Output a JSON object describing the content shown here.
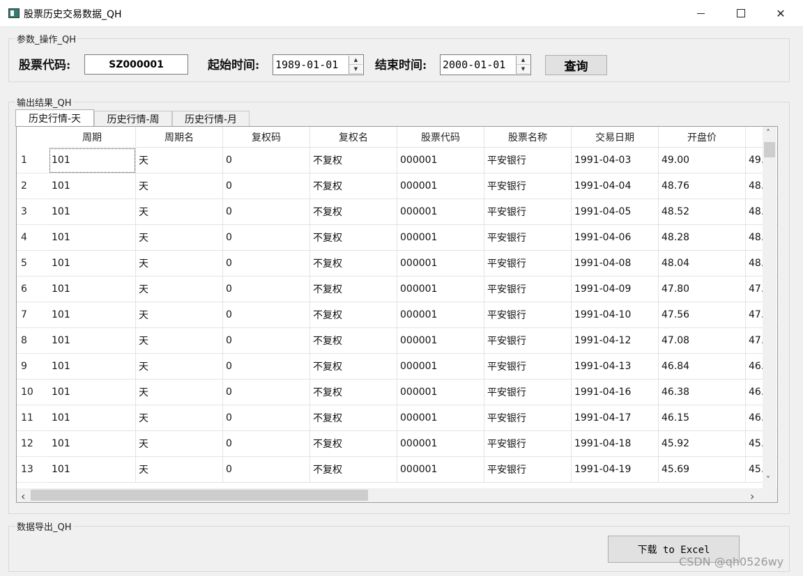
{
  "window": {
    "title": "股票历史交易数据_QH",
    "minimize": "—",
    "close": "✕"
  },
  "params": {
    "group_title": "参数_操作_QH",
    "code_label": "股票代码:",
    "code_value": "SZ000001",
    "start_label": "起始时间:",
    "start_value": "1989-01-01",
    "end_label": "结束时间:",
    "end_value": "2000-01-01",
    "query_label": "查询"
  },
  "output": {
    "group_title": "输出结果_QH",
    "tabs": [
      {
        "label": "历史行情-天",
        "active": true
      },
      {
        "label": "历史行情-周",
        "active": false
      },
      {
        "label": "历史行情-月",
        "active": false
      }
    ],
    "columns": [
      "周期",
      "周期名",
      "复权码",
      "复权名",
      "股票代码",
      "股票名称",
      "交易日期",
      "开盘价",
      ""
    ],
    "rows": [
      {
        "n": "1",
        "cells": [
          "101",
          "天",
          "0",
          "不复权",
          "000001",
          "平安银行",
          "1991-04-03",
          "49.00",
          "49."
        ]
      },
      {
        "n": "2",
        "cells": [
          "101",
          "天",
          "0",
          "不复权",
          "000001",
          "平安银行",
          "1991-04-04",
          "48.76",
          "48."
        ]
      },
      {
        "n": "3",
        "cells": [
          "101",
          "天",
          "0",
          "不复权",
          "000001",
          "平安银行",
          "1991-04-05",
          "48.52",
          "48."
        ]
      },
      {
        "n": "4",
        "cells": [
          "101",
          "天",
          "0",
          "不复权",
          "000001",
          "平安银行",
          "1991-04-06",
          "48.28",
          "48."
        ]
      },
      {
        "n": "5",
        "cells": [
          "101",
          "天",
          "0",
          "不复权",
          "000001",
          "平安银行",
          "1991-04-08",
          "48.04",
          "48."
        ]
      },
      {
        "n": "6",
        "cells": [
          "101",
          "天",
          "0",
          "不复权",
          "000001",
          "平安银行",
          "1991-04-09",
          "47.80",
          "47."
        ]
      },
      {
        "n": "7",
        "cells": [
          "101",
          "天",
          "0",
          "不复权",
          "000001",
          "平安银行",
          "1991-04-10",
          "47.56",
          "47."
        ]
      },
      {
        "n": "8",
        "cells": [
          "101",
          "天",
          "0",
          "不复权",
          "000001",
          "平安银行",
          "1991-04-12",
          "47.08",
          "47."
        ]
      },
      {
        "n": "9",
        "cells": [
          "101",
          "天",
          "0",
          "不复权",
          "000001",
          "平安银行",
          "1991-04-13",
          "46.84",
          "46."
        ]
      },
      {
        "n": "10",
        "cells": [
          "101",
          "天",
          "0",
          "不复权",
          "000001",
          "平安银行",
          "1991-04-16",
          "46.38",
          "46."
        ]
      },
      {
        "n": "11",
        "cells": [
          "101",
          "天",
          "0",
          "不复权",
          "000001",
          "平安银行",
          "1991-04-17",
          "46.15",
          "46."
        ]
      },
      {
        "n": "12",
        "cells": [
          "101",
          "天",
          "0",
          "不复权",
          "000001",
          "平安银行",
          "1991-04-18",
          "45.92",
          "45."
        ]
      },
      {
        "n": "13",
        "cells": [
          "101",
          "天",
          "0",
          "不复权",
          "000001",
          "平安银行",
          "1991-04-19",
          "45.69",
          "45."
        ]
      }
    ]
  },
  "export": {
    "group_title": "数据导出_QH",
    "download_label": "下载 to Excel"
  },
  "watermark": "CSDN @qh0526wy",
  "icons": {
    "up": "▲",
    "down": "▼",
    "left": "‹",
    "right": "›",
    "scroll_up": "˄",
    "scroll_down": "˅"
  }
}
